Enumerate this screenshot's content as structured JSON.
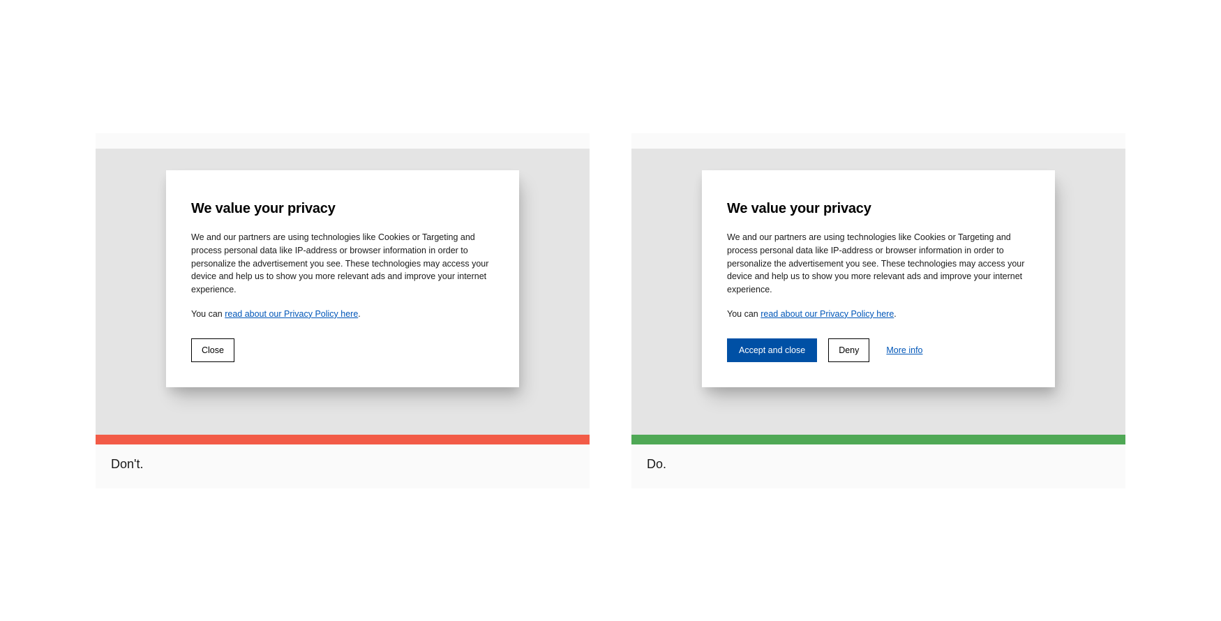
{
  "dont": {
    "caption": "Don't.",
    "status_color": "#f25b47",
    "modal": {
      "title": "We value your privacy",
      "body": "We and our partners are using technologies like Cookies or Targeting and process personal data like IP-address or browser information in order to personalize the advertisement you see. These technologies may access your device and help us to show you more relevant ads and improve your internet experience.",
      "policy_prefix": "You can ",
      "policy_link": "read about our Privacy Policy here",
      "policy_suffix": ".",
      "close_label": "Close"
    }
  },
  "do": {
    "caption": "Do.",
    "status_color": "#4fa855",
    "modal": {
      "title": "We value your privacy",
      "body": "We and our partners are using technologies like Cookies or Targeting and process personal data like IP-address or browser information in order to personalize the advertisement you see. These technologies may access your device and help us to show you more relevant ads and improve your internet experience.",
      "policy_prefix": "You can ",
      "policy_link": "read about our Privacy Policy here",
      "policy_suffix": ".",
      "accept_label": "Accept and close",
      "deny_label": "Deny",
      "more_info_label": "More info"
    }
  }
}
